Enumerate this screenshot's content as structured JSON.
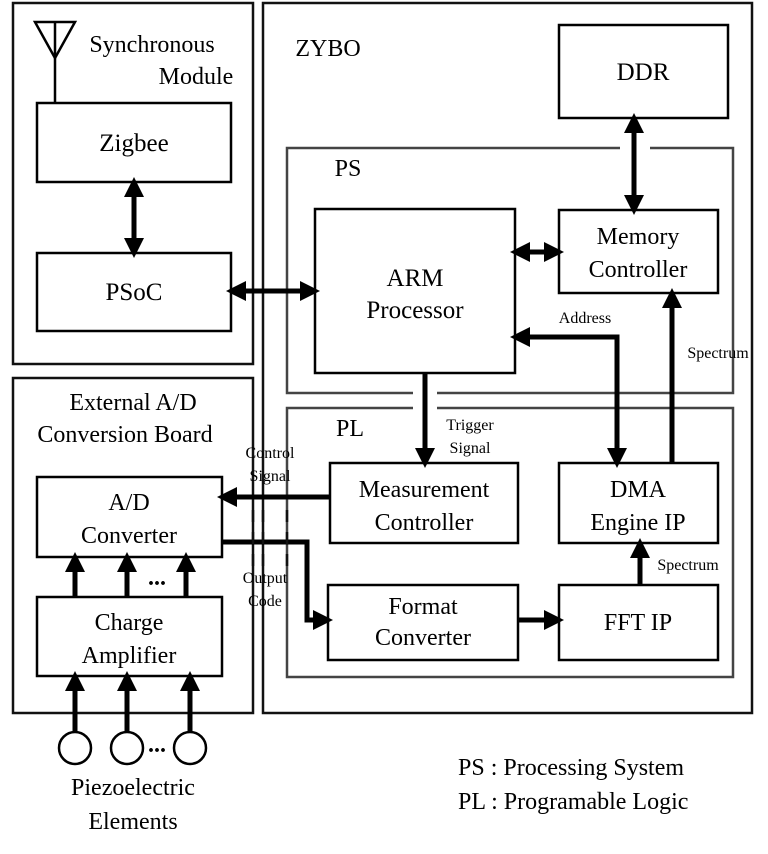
{
  "sync_module": {
    "title_line1": "Synchronous",
    "title_line2": "Module",
    "zigbee": "Zigbee",
    "psoc": "PSoC"
  },
  "zybo": {
    "title": "ZYBO",
    "ddr": "DDR",
    "ps_label": "PS",
    "pl_label": "PL",
    "arm_line1": "ARM",
    "arm_line2": "Processor",
    "mem_line1": "Memory",
    "mem_line2": "Controller",
    "meas_line1": "Measurement",
    "meas_line2": "Controller",
    "dma_line1": "DMA",
    "dma_line2": "Engine IP",
    "format_line1": "Format",
    "format_line2": "Converter",
    "fft": "FFT IP",
    "address_label": "Address",
    "spectrum_label_upper": "Spectrum",
    "spectrum_label_lower": "Spectrum",
    "trigger_line1": "Trigger",
    "trigger_line2": "Signal"
  },
  "adc_board": {
    "title_line1": "External A/D",
    "title_line2": "Conversion Board",
    "adc_line1": "A/D",
    "adc_line2": "Converter",
    "amp_line1": "Charge",
    "amp_line2": "Amplifier",
    "ellipsis": "...",
    "control_line1": "Control",
    "control_line2": "Signal",
    "output_line1": "Output",
    "output_line2": "Code"
  },
  "piezo": {
    "label_line1": "Piezoelectric",
    "label_line2": "Elements",
    "ellipsis": "..."
  },
  "legend": {
    "ps": "PS : Processing System",
    "pl": "PL : Programable Logic"
  }
}
